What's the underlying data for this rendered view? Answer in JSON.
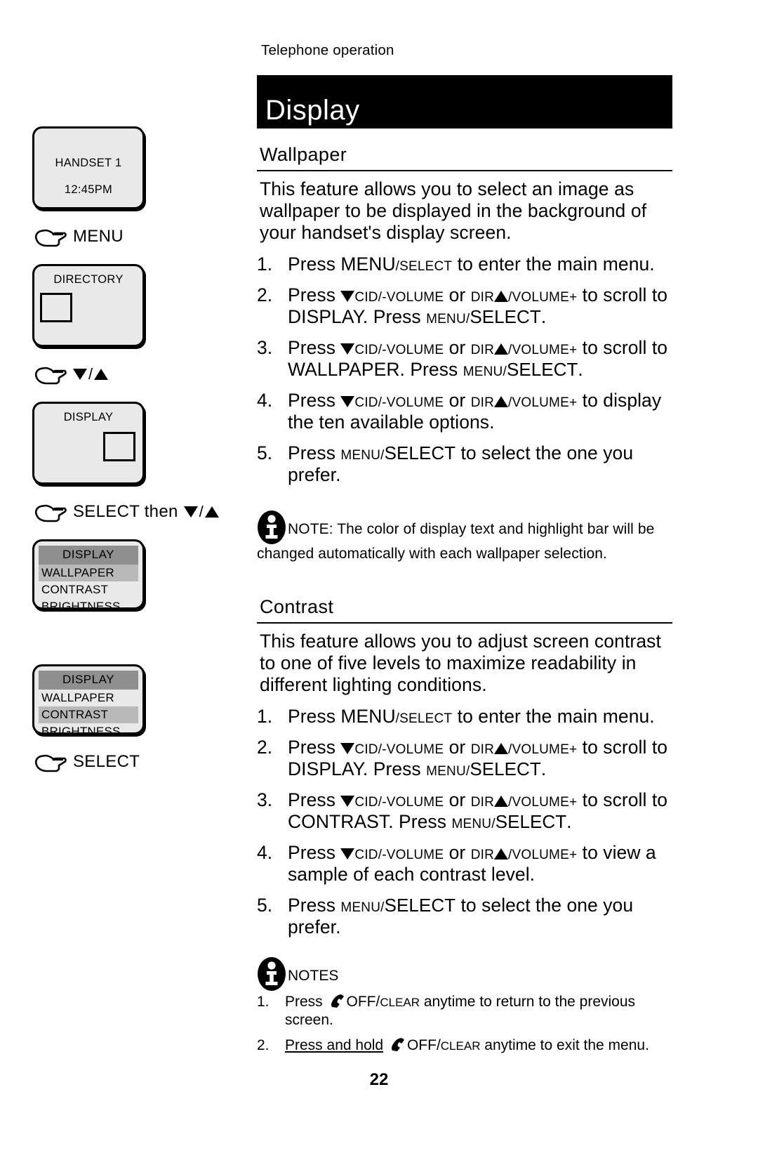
{
  "document": {
    "kicker": "Telephone operation",
    "title": "Display",
    "page_number": "22"
  },
  "sidebar": {
    "handset_screen": {
      "line1": "HANDSET 1",
      "line2": "12:45PM"
    },
    "label_menu": "MENU",
    "directory_screen": {
      "title": "DIRECTORY"
    },
    "label_updown": "",
    "display_screen": {
      "title": "DISPLAY"
    },
    "label_select_then": "SELECT then",
    "label_select": "SELECT",
    "menu_screen_1": {
      "header": "DISPLAY",
      "items": [
        {
          "label": "WALLPAPER",
          "highlighted": true
        },
        {
          "label": "CONTRAST",
          "highlighted": false
        },
        {
          "label": "BRIGHTNESS",
          "highlighted": false
        }
      ]
    },
    "menu_screen_2": {
      "header": "DISPLAY",
      "items": [
        {
          "label": "WALLPAPER",
          "highlighted": false
        },
        {
          "label": "CONTRAST",
          "highlighted": true
        },
        {
          "label": "BRIGHTNESS",
          "highlighted": false
        }
      ]
    }
  },
  "keys": {
    "menu": "MENU",
    "select": "SELECT",
    "slash": "/",
    "cid": "CID/",
    "vol_down": "-VOLUME",
    "dir": "DIR",
    "vol_up": "VOLUME+",
    "or": "or",
    "off": "OFF",
    "clear": "CLEAR"
  },
  "wallpaper": {
    "heading": "Wallpaper",
    "intro": "This feature allows you to select an image as wallpaper to be displayed in the background of your handset's display screen.",
    "steps": [
      {
        "num": "1.",
        "pre": "Press ",
        "post": " to enter the main menu."
      },
      {
        "num": "2.",
        "pre": "Press ",
        "mid": " to scroll to ",
        "target": "DISPLAY. Press ",
        "post": "."
      },
      {
        "num": "3.",
        "pre": "Press ",
        "mid": " to scroll to ",
        "target": "WALLPAPER. Press ",
        "post": "."
      },
      {
        "num": "4.",
        "pre": "Press ",
        "post": " to display the ten available options."
      },
      {
        "num": "5.",
        "pre": "Press ",
        "post": " to select the one you prefer."
      }
    ],
    "note": "NOTE: The color of display text and highlight bar will be changed automatically with each wallpaper selection."
  },
  "contrast": {
    "heading": "Contrast",
    "intro": "This feature allows you to adjust screen contrast to one of five levels to maximize readability in different lighting conditions.",
    "steps": [
      {
        "num": "1.",
        "pre": "Press ",
        "post": " to enter the main menu."
      },
      {
        "num": "2.",
        "pre": "Press ",
        "mid": " to scroll to ",
        "target": "DISPLAY. Press ",
        "post": "."
      },
      {
        "num": "3.",
        "pre": "Press ",
        "mid": " to scroll to ",
        "target": "CONTRAST. Press ",
        "post": "."
      },
      {
        "num": "4.",
        "pre": "Press ",
        "post": " to view a sample of each contrast level."
      },
      {
        "num": "5.",
        "pre": "Press ",
        "post": " to select the one you prefer."
      }
    ],
    "notes_head": "NOTES",
    "notes": [
      {
        "num": "1.",
        "pre": "Press ",
        "post": " anytime to return to the previous screen.",
        "emphasis": ""
      },
      {
        "num": "2.",
        "emphasis": "Press and hold",
        "pre": " ",
        "post": " anytime to exit the menu."
      }
    ]
  }
}
